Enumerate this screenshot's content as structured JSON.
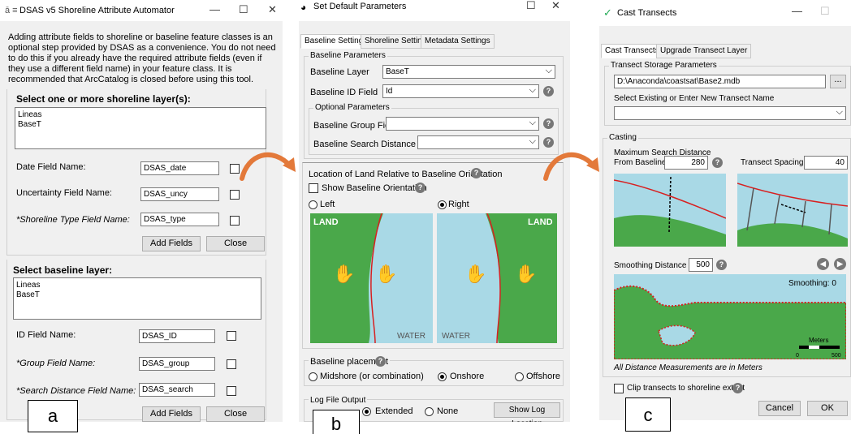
{
  "a": {
    "title": "DSAS v5 Shoreline Attribute Automator",
    "intro": "Adding attribute fields to shoreline or baseline feature classes is an optional step provided by DSAS as a convenience. You do not need to do this if you already have the required attribute fields (even if they use a different field name) in your feature class.  It is recommended that ArcCatalog is closed before using this tool.",
    "shoreline_heading": "Select one or more shoreline layer(s):",
    "shoreline_layers": [
      "Lineas",
      "BaseT"
    ],
    "fields1": [
      {
        "label": "Date Field Name:",
        "value": "DSAS_date",
        "italic": false
      },
      {
        "label": "Uncertainty Field Name:",
        "value": "DSAS_uncy",
        "italic": false
      },
      {
        "label": "*Shoreline Type Field Name:",
        "value": "DSAS_type",
        "italic": true
      }
    ],
    "add_fields": "Add Fields",
    "close": "Close",
    "baseline_heading": "Select baseline layer:",
    "baseline_layers": [
      "Lineas",
      "BaseT"
    ],
    "fields2": [
      {
        "label": "ID Field Name:",
        "value": "DSAS_ID",
        "italic": false
      },
      {
        "label": "*Group Field Name:",
        "value": "DSAS_group",
        "italic": true
      },
      {
        "label": "*Search Distance Field Name:",
        "value": "DSAS_search",
        "italic": true
      }
    ],
    "letter": "a"
  },
  "b": {
    "title": "Set Default Parameters",
    "tabs": [
      "Baseline Settings",
      "Shoreline Settings",
      "Metadata Settings"
    ],
    "baseline_params": "Baseline Parameters",
    "baseline_layer_label": "Baseline Layer",
    "baseline_layer_value": "BaseT",
    "baseline_id_label": "Baseline ID Field",
    "baseline_id_value": "Id",
    "optional_params": "Optional Parameters",
    "group_field_label": "Baseline Group Field",
    "search_field_label": "Baseline Search Distance Field",
    "location_label": "Location of Land Relative to Baseline Orientation",
    "show_orientation": "Show Baseline Orientation",
    "left": "Left",
    "right": "Right",
    "land": "LAND",
    "water": "WATER",
    "placement_label": "Baseline placement",
    "placement_opts": [
      "Midshore (or combination)",
      "Onshore",
      "Offshore"
    ],
    "log_label": "Log File Output",
    "extended": "Extended",
    "none": "None",
    "show_log": "Show Log Location",
    "letter": "b"
  },
  "c": {
    "title": "Cast Transects",
    "tabs": [
      "Cast Transects",
      "Upgrade Transect Layer"
    ],
    "storage_label": "Transect Storage Parameters",
    "path": "D:\\Anaconda\\coastsat\\Base2.mdb",
    "browse": "...",
    "select_label": "Select Existing or Enter New Transect Name",
    "casting": "Casting",
    "max_search": "Maximum Search Distance",
    "from_baseline": "From Baseline",
    "max_value": "280",
    "spacing_label": "Transect Spacing",
    "spacing_value": "40",
    "smoothing_label": "Smoothing Distance",
    "smoothing_value": "500",
    "smoothing_map": "Smoothing: 0",
    "meters": "Meters",
    "scale_0": "0",
    "scale_500": "500",
    "all_dist": "All Distance Measurements are in Meters",
    "clip": "Clip transects to shoreline extent",
    "cancel": "Cancel",
    "ok": "OK",
    "letter": "c"
  }
}
